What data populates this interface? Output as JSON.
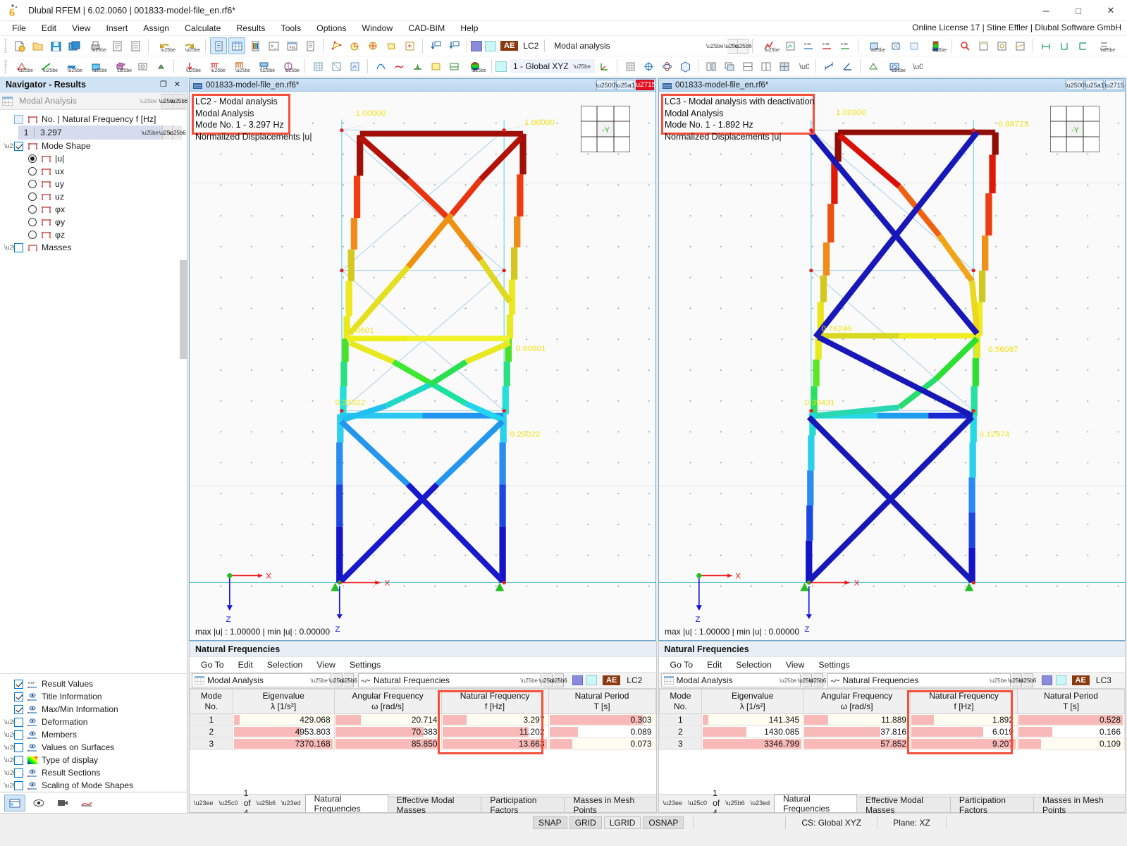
{
  "window": {
    "title": "Dlubal RFEM | 6.02.0060 | 001833-model-file_en.rf6*",
    "minimize": "─",
    "maximize": "□",
    "close": "✕"
  },
  "menubar": {
    "items": [
      "File",
      "Edit",
      "View",
      "Insert",
      "Assign",
      "Calculate",
      "Results",
      "Tools",
      "Options",
      "Window",
      "CAD-BIM",
      "Help"
    ],
    "license": "Online License 17 | Stine Effler | Dlubal Software GmbH"
  },
  "toolbar": {
    "load_case_badge": "AE",
    "load_case_id": "LC2",
    "load_case_name": "Modal analysis",
    "coord_system": "1 - Global XYZ"
  },
  "navigator": {
    "title": "Navigator - Results",
    "undock_icon": "❐",
    "close_icon": "✕",
    "selector": "Modal Analysis",
    "tree": {
      "frequency_header": "No. | Natural Frequency f [Hz]",
      "frequency_no": "1",
      "frequency_value": "3.297",
      "mode_shape": "Mode Shape",
      "components": [
        "|u|",
        "uх",
        "uу",
        "uᴢ",
        "φх",
        "φу",
        "φᴢ"
      ],
      "masses": "Masses"
    },
    "display_items": [
      {
        "label": "Result Values",
        "checked": true,
        "expandable": false
      },
      {
        "label": "Title Information",
        "checked": true,
        "expandable": false
      },
      {
        "label": "Max/Min Information",
        "checked": true,
        "expandable": false
      },
      {
        "label": "Deformation",
        "checked": false,
        "expandable": true
      },
      {
        "label": "Members",
        "checked": false,
        "expandable": true
      },
      {
        "label": "Values on Surfaces",
        "checked": false,
        "expandable": true
      },
      {
        "label": "Type of display",
        "checked": false,
        "expandable": true
      },
      {
        "label": "Result Sections",
        "checked": false,
        "expandable": true
      },
      {
        "label": "Scaling of Mode Shapes",
        "checked": false,
        "expandable": true
      }
    ]
  },
  "viewports": [
    {
      "title": "001833-model-file_en.rf6*",
      "annotation": [
        "LC2 - Modal analysis",
        "Modal Analysis",
        "Mode No. 1 - 3.297 Hz",
        "Normalized Displacements |u|"
      ],
      "maxmin": "max |u| : 1.00000 | min |u| : 0.00000",
      "axis_x": "X",
      "axis_z": "Z",
      "cube_label": "-Y",
      "node_values": [
        "1.00000",
        "1.00000",
        "0.60601",
        "0.60601",
        "0.25022",
        "0.25022"
      ]
    },
    {
      "title": "001833-model-file_en.rf6*",
      "annotation": [
        "LC3 - Modal analysis with deactivation",
        "Modal Analysis",
        "Mode No. 1 - 1.892 Hz",
        "Normalized Displacements |u|"
      ],
      "maxmin": "max |u| : 1.00000 | min |u| : 0.00000",
      "axis_x": "X",
      "axis_z": "Z",
      "cube_label": "-Y",
      "node_values": [
        "1.00000",
        "0.98723",
        "0.76246",
        "0.56087",
        "0.39431",
        "0.12974"
      ]
    }
  ],
  "tables": [
    {
      "caption": "Natural Frequencies",
      "menu": [
        "Go To",
        "Edit",
        "Selection",
        "View",
        "Settings"
      ],
      "combo_left": "Modal Analysis",
      "combo_right": "Natural Frequencies",
      "lc_badge": "AE",
      "lc_id": "LC2",
      "headers": [
        {
          "l1": "Mode",
          "l2": "No."
        },
        {
          "l1": "Eigenvalue",
          "l2": "λ [1/s²]"
        },
        {
          "l1": "Angular Frequency",
          "l2": "ω [rad/s]"
        },
        {
          "l1": "Natural Frequency",
          "l2": "f [Hz]"
        },
        {
          "l1": "Natural Period",
          "l2": "T [s]"
        }
      ],
      "rows": [
        {
          "no": "1",
          "eigenvalue": "429.068",
          "omega": "20.714",
          "freq": "3.297",
          "period": "0.303",
          "bars": [
            0.06,
            0.25,
            0.24,
            0.88
          ]
        },
        {
          "no": "2",
          "eigenvalue": "4953.803",
          "omega": "70.383",
          "freq": "11.202",
          "period": "0.089",
          "bars": [
            0.67,
            0.84,
            0.82,
            0.26
          ]
        },
        {
          "no": "3",
          "eigenvalue": "7370.168",
          "omega": "85.850",
          "freq": "13.663",
          "period": "0.073",
          "bars": [
            1.0,
            1.0,
            1.0,
            0.21
          ]
        }
      ],
      "pager": "1 of 4",
      "tabs": [
        "Natural Frequencies",
        "Effective Modal Masses",
        "Participation Factors",
        "Masses in Mesh Points"
      ],
      "active_tab": "Natural Frequencies"
    },
    {
      "caption": "Natural Frequencies",
      "menu": [
        "Go To",
        "Edit",
        "Selection",
        "View",
        "Settings"
      ],
      "combo_left": "Modal Analysis",
      "combo_right": "Natural Frequencies",
      "lc_badge": "AE",
      "lc_id": "LC3",
      "headers": [
        {
          "l1": "Mode",
          "l2": "No."
        },
        {
          "l1": "Eigenvalue",
          "l2": "λ [1/s²]"
        },
        {
          "l1": "Angular Frequency",
          "l2": "ω [rad/s]"
        },
        {
          "l1": "Natural Frequency",
          "l2": "f [Hz]"
        },
        {
          "l1": "Natural Period",
          "l2": "T [s]"
        }
      ],
      "rows": [
        {
          "no": "1",
          "eigenvalue": "141.345",
          "omega": "11.889",
          "freq": "1.892",
          "period": "0.528",
          "bars": [
            0.05,
            0.23,
            0.22,
            1.0
          ]
        },
        {
          "no": "2",
          "eigenvalue": "1430.085",
          "omega": "37.816",
          "freq": "6.019",
          "period": "0.166",
          "bars": [
            0.43,
            0.72,
            0.68,
            0.32
          ]
        },
        {
          "no": "3",
          "eigenvalue": "3346.799",
          "omega": "57.852",
          "freq": "9.207",
          "period": "0.109",
          "bars": [
            1.0,
            1.0,
            1.0,
            0.21
          ]
        }
      ],
      "pager": "1 of 4",
      "tabs": [
        "Natural Frequencies",
        "Effective Modal Masses",
        "Participation Factors",
        "Masses in Mesh Points"
      ],
      "active_tab": "Natural Frequencies"
    }
  ],
  "statusbar": {
    "toggles": [
      "SNAP",
      "GRID",
      "LGRID",
      "OSNAP"
    ],
    "cs": "CS: Global XYZ",
    "plane": "Plane: XZ"
  },
  "colors": {
    "accent_red": "#f4503c",
    "titlebar_blue": "#cfe3f5",
    "bar_pink": "#f7b3b3"
  }
}
